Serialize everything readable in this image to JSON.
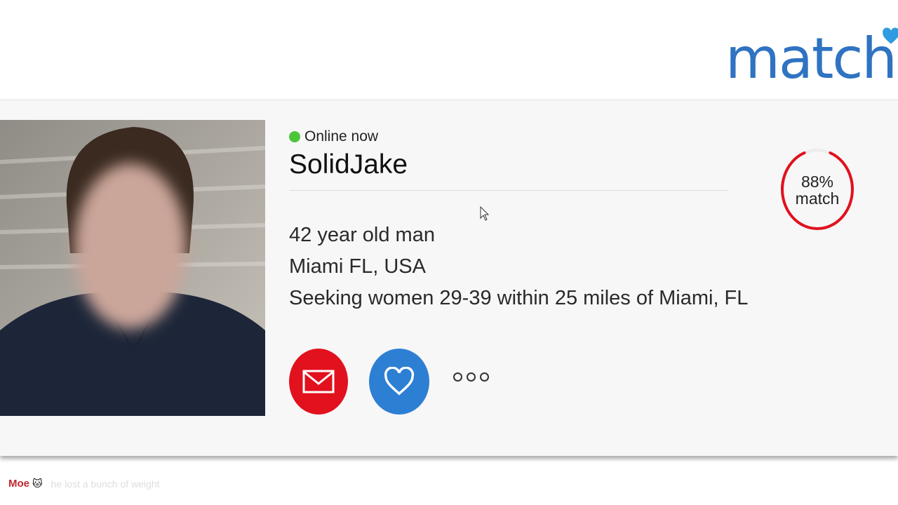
{
  "brand": {
    "logo_text": "match",
    "logo_color": "#2f73c2"
  },
  "profile": {
    "status": "Online now",
    "status_color": "#4cc53a",
    "username": "SolidJake",
    "details": [
      "42 year old man",
      "Miami FL, USA",
      "Seeking women 29-39 within 25 miles of Miami, FL"
    ],
    "match_percent": "88%",
    "match_label": "match",
    "match_fraction": 0.88,
    "match_color": "#e2111e"
  },
  "actions": {
    "message_icon": "envelope-icon",
    "message_color": "#e2111e",
    "like_icon": "heart-icon",
    "like_color": "#2d7fd3",
    "more_icon": "more-dots-icon"
  },
  "chat": {
    "user": "Moe",
    "emote": "🐱",
    "message": "he lost a bunch of weight"
  }
}
